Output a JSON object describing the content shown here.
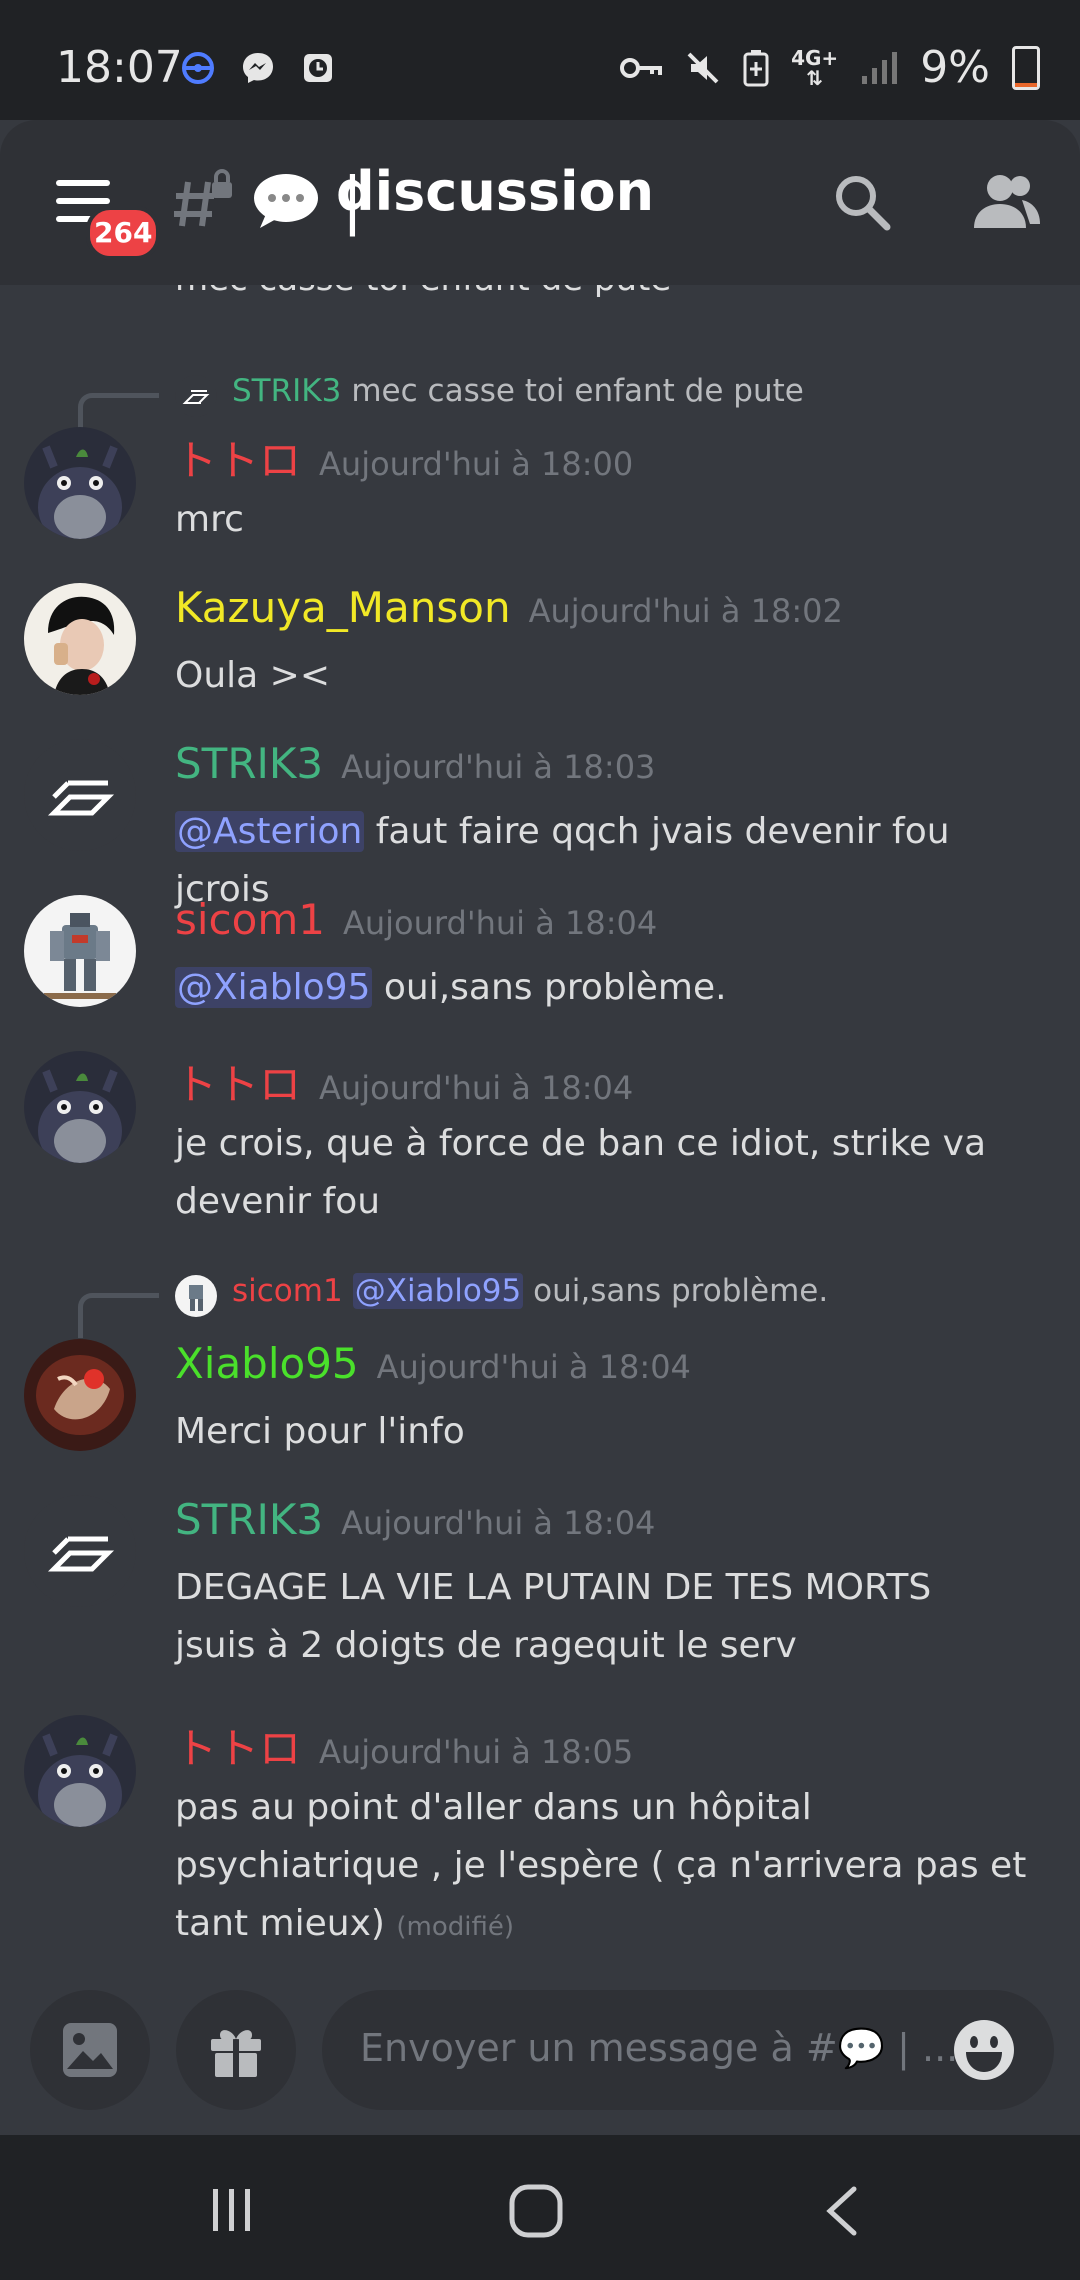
{
  "status_bar": {
    "time": "18:07",
    "network": "4G+",
    "battery": "9%",
    "battery_level": 0.09,
    "left_icons": [
      "vpn-icon",
      "messenger-icon",
      "clock-app-icon"
    ],
    "right_icons": [
      "key-icon",
      "mute-icon",
      "battery-saver-icon",
      "data-arrows-icon",
      "signal-icon",
      "battery-icon"
    ]
  },
  "header": {
    "unread_badge": "264",
    "channel_separator": "|",
    "channel_name": "discussion",
    "icons": [
      "menu-icon",
      "locked-channel-icon",
      "speech-bubble-icon",
      "search-icon",
      "members-icon"
    ]
  },
  "colors": {
    "strik3": "#43b581",
    "totoro": "#ed4245",
    "kazuya": "#f1e826",
    "sicom1": "#ed4245",
    "xiablo": "#4ae02b",
    "mention": "#8fa2ff",
    "timestamp": "#72767d"
  },
  "cut_message": "mec casse toi enfant de pute",
  "replies": {
    "r1": {
      "author": "STRIK3",
      "text": "mec casse toi enfant de pute"
    },
    "r2": {
      "author": "sicom1",
      "mention": "@Xiablo95",
      "text": "oui,sans problème."
    }
  },
  "messages": [
    {
      "author": "トトロ",
      "time": "Aujourd'hui à 18:00",
      "text": "mrc"
    },
    {
      "author": "Kazuya_Manson",
      "time": "Aujourd'hui à 18:02",
      "text": "Oula ><"
    },
    {
      "author": "STRIK3",
      "time": "Aujourd'hui à 18:03",
      "mention": "@Asterion",
      "text": "faut faire qqch jvais devenir fou jcrois"
    },
    {
      "author": "sicom1",
      "time": "Aujourd'hui à 18:04",
      "mention": "@Xiablo95",
      "text": "oui,sans problème."
    },
    {
      "author": "トトロ",
      "time": "Aujourd'hui à 18:04",
      "text": "je crois, que à force de ban ce idiot, strike va devenir fou"
    },
    {
      "author": "Xiablo95",
      "time": "Aujourd'hui à 18:04",
      "text": "Merci pour l'info"
    },
    {
      "author": "STRIK3",
      "time": "Aujourd'hui à 18:04",
      "line1": "DEGAGE LA VIE LA PUTAIN DE TES MORTS",
      "line2": "jsuis à 2 doigts de ragequit le serv"
    },
    {
      "author": "トトロ",
      "time": "Aujourd'hui à 18:05",
      "text": "pas au point d'aller dans un hôpital psychiatrique , je l'espère ( ça n'arrivera pas et tant mieux)",
      "edited": "(modifié)"
    }
  ],
  "composer": {
    "placeholder": "Envoyer un message à #💬 | ...",
    "icons": [
      "image-icon",
      "gift-icon",
      "emoji-icon"
    ]
  },
  "nav": {
    "icons": [
      "recents-icon",
      "home-icon",
      "back-icon"
    ]
  }
}
